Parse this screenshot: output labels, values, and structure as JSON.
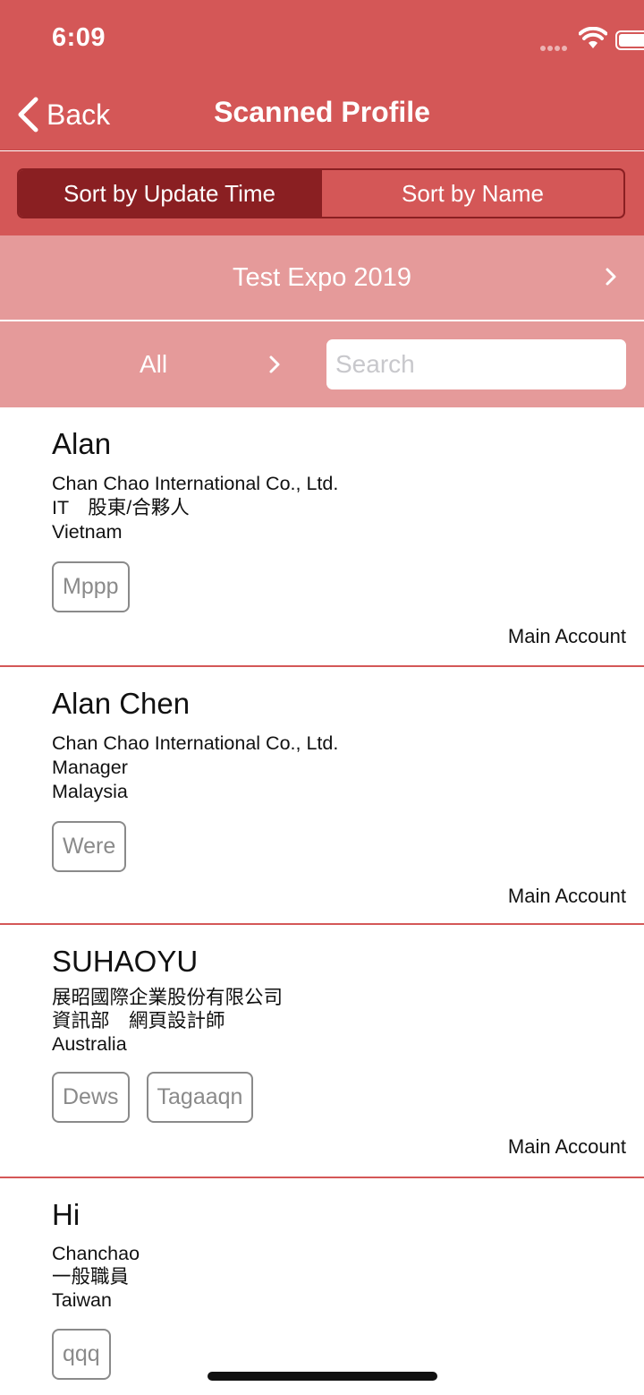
{
  "status": {
    "time": "6:09"
  },
  "nav": {
    "back_label": "Back",
    "title": "Scanned Profile"
  },
  "sort": {
    "update_time": "Sort by Update Time",
    "name": "Sort by Name",
    "selected": "update_time"
  },
  "expo": {
    "label": "Test Expo 2019"
  },
  "filter": {
    "label": "All",
    "search_placeholder": "Search"
  },
  "profiles": [
    {
      "name": "Alan",
      "company": "Chan Chao International Co., Ltd.",
      "title": "IT　股東/合夥人",
      "country": "Vietnam",
      "tags": [
        "Mppp"
      ],
      "account": "Main Account"
    },
    {
      "name": "Alan Chen",
      "company": "Chan Chao International Co., Ltd.",
      "title": "Manager",
      "country": "Malaysia",
      "tags": [
        "Were"
      ],
      "account": "Main Account"
    },
    {
      "name": "SUHAOYU",
      "company": "展昭國際企業股份有限公司",
      "title": "資訊部　網頁設計師",
      "country": "Australia",
      "tags": [
        "Dews",
        "Tagaaqn"
      ],
      "account": "Main Account"
    },
    {
      "name": "Hi",
      "company": "Chanchao",
      "title": "一般職員",
      "country": "Taiwan",
      "tags": [
        "qqq"
      ],
      "account": ""
    }
  ],
  "colors": {
    "header": "#d45757",
    "segment_active": "#8a1f22",
    "expo_band": "#e59a9a",
    "separator": "#d45757"
  }
}
